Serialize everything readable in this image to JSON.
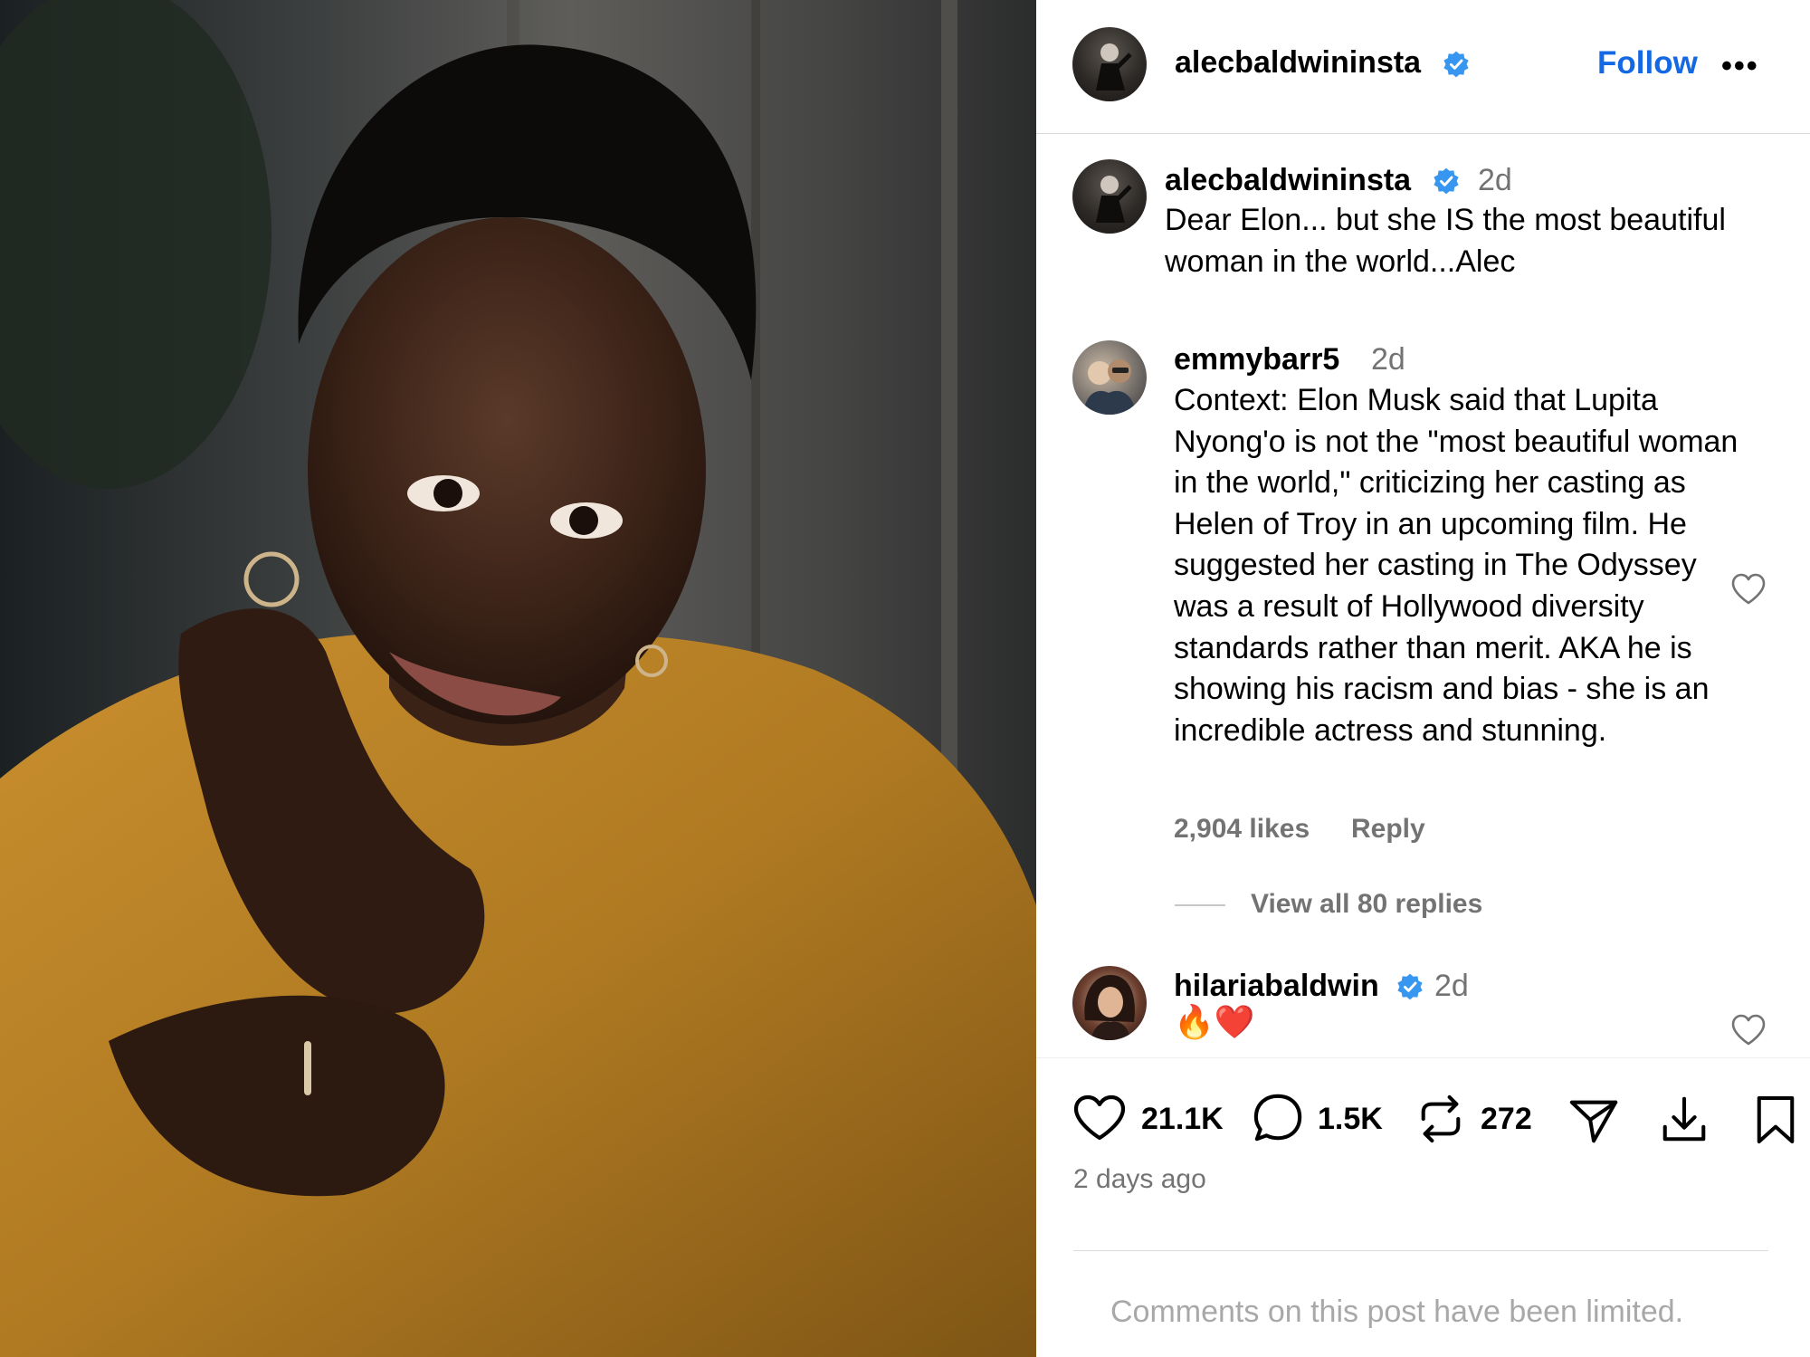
{
  "post": {
    "author": "alecbaldwininsta",
    "follow_label": "Follow",
    "more_label": "•••",
    "caption_time": "2d",
    "caption": "Dear Elon... but she IS the most beautiful woman in the world...Alec",
    "posted_ago": "2 days ago",
    "limited_notice": "Comments on this post have been limited."
  },
  "comments": [
    {
      "user": "emmybarr5",
      "time": "2d",
      "text": "Context: Elon Musk said that Lupita Nyong'o is not the \"most beautiful woman in the world,\" criticizing her casting as Helen of Troy in an upcoming film. He suggested her casting in The Odyssey was a result of Hollywood diversity standards rather than merit. AKA he is showing his racism and bias - she is an incredible actress and stunning.",
      "likes": "2,904 likes",
      "reply_label": "Reply",
      "view_replies": "View all 80 replies"
    },
    {
      "user": "hilariabaldwin",
      "time": "2d",
      "text": "🔥❤️"
    }
  ],
  "actions": {
    "likes_count": "21.1K",
    "comments_count": "1.5K",
    "reposts_count": "272"
  },
  "colors": {
    "link_blue": "#1468e3",
    "verified_blue": "#3797f0",
    "secondary_text": "#737373",
    "muted_text": "#a8a8a8"
  },
  "icons": [
    "verified-badge-icon",
    "heart-icon",
    "comment-icon",
    "repost-icon",
    "share-icon",
    "download-icon",
    "bookmark-icon"
  ]
}
